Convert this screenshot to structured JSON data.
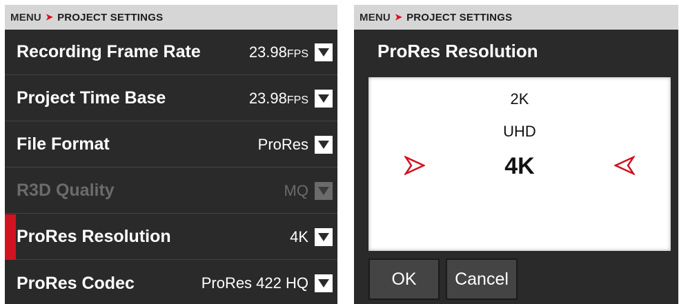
{
  "left_panel": {
    "breadcrumb": {
      "menu": "MENU",
      "separator": "➤",
      "current": "PROJECT SETTINGS"
    },
    "rows": [
      {
        "label": "Recording Frame Rate",
        "value": "23.98",
        "unit": "FPS"
      },
      {
        "label": "Project Time Base",
        "value": "23.98",
        "unit": "FPS"
      },
      {
        "label": "File Format",
        "value": "ProRes",
        "unit": ""
      },
      {
        "label": "R3D Quality",
        "value": "MQ",
        "unit": "",
        "disabled": true
      },
      {
        "label": "ProRes Resolution",
        "value": "4K",
        "unit": "",
        "selected": true
      },
      {
        "label": "ProRes Codec",
        "value": "ProRes 422 HQ",
        "unit": ""
      }
    ]
  },
  "right_panel": {
    "breadcrumb": {
      "menu": "MENU",
      "separator": "➤",
      "current": "PROJECT SETTINGS"
    },
    "title": "ProRes Resolution",
    "options": [
      "2K",
      "UHD",
      "4K"
    ],
    "selected_option": "4K",
    "ok_label": "OK",
    "cancel_label": "Cancel"
  },
  "colors": {
    "accent": "#d1121f",
    "panel_bg": "#2a2a2a",
    "breadcrumb_bg": "#d6d6d6"
  },
  "icons": {
    "dropdown": "chevron-down-icon",
    "arrow_left": "arrow-right-outline-icon",
    "arrow_right": "arrow-left-outline-icon"
  }
}
